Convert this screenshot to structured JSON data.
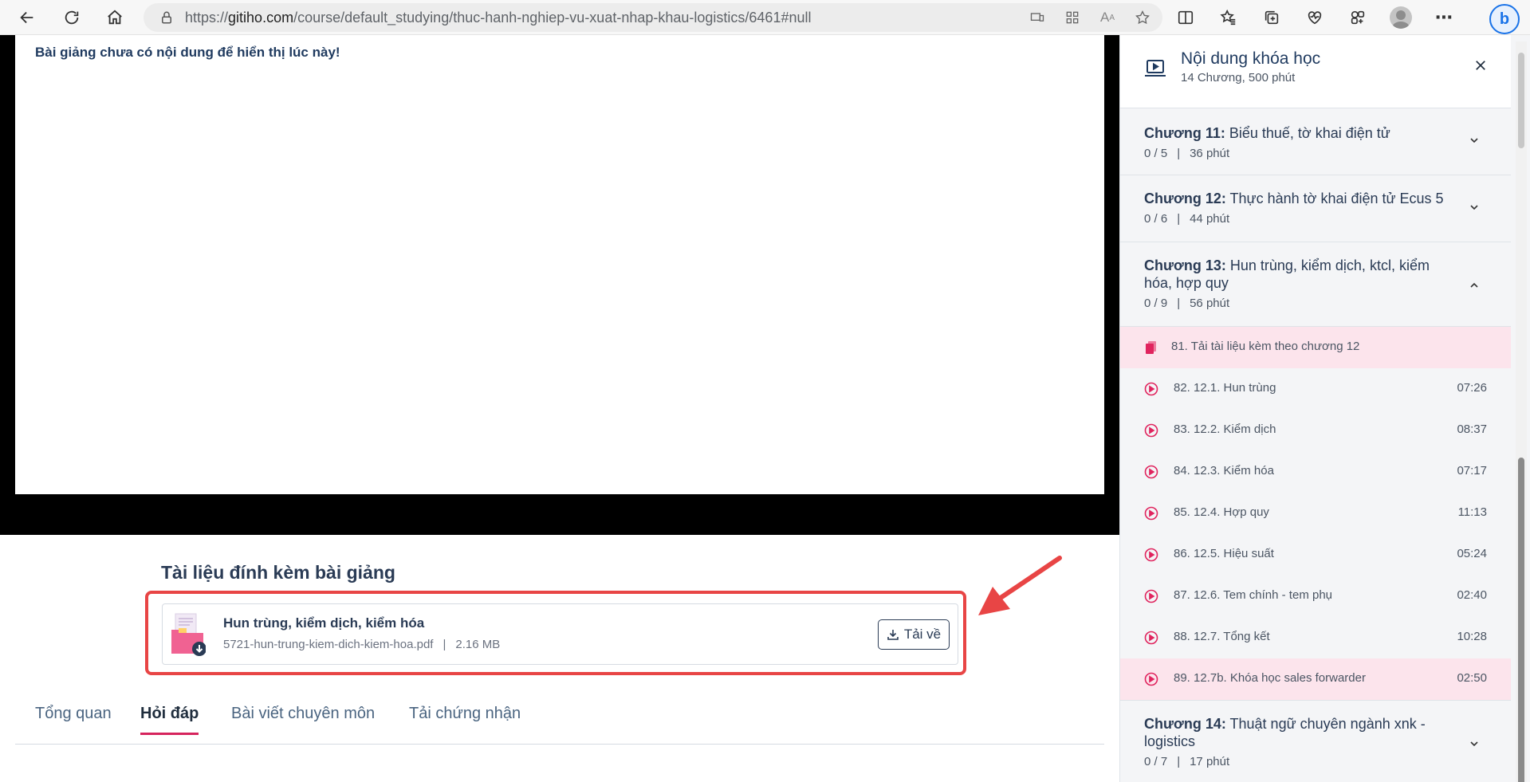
{
  "browser": {
    "url_prefix": "https://",
    "url_domain": "gitiho.com",
    "url_path": "/course/default_studying/thuc-hanh-nghiep-vu-xuat-nhap-khau-logistics/6461#null"
  },
  "lesson": {
    "empty_message": "Bài giảng chưa có nội dung để hiển thị lúc này!"
  },
  "attachments": {
    "title": "Tài liệu đính kèm bài giảng",
    "file_name": "Hun trùng, kiểm dịch, kiểm hóa",
    "file_path": "5721-hun-trung-kiem-dich-kiem-hoa.pdf",
    "file_size": "2.16 MB",
    "separator": "|",
    "download_label": "Tải về"
  },
  "tabs": [
    "Tổng quan",
    "Hỏi đáp",
    "Bài viết chuyên môn",
    "Tải chứng nhận"
  ],
  "active_tab": "Hỏi đáp",
  "sidebar": {
    "title": "Nội dung khóa học",
    "subtitle": "14 Chương, 500 phút",
    "chapters": [
      {
        "label": "Chương 11:",
        "name": "Biểu thuế, tờ khai điện tử",
        "progress": "0 / 5",
        "duration": "36 phút"
      },
      {
        "label": "Chương 12:",
        "name": "Thực hành tờ khai điện tử Ecus 5",
        "progress": "0 / 6",
        "duration": "44 phút"
      },
      {
        "label": "Chương 13:",
        "name": "Hun trùng, kiểm dịch, ktcl, kiểm hóa, hợp quy",
        "progress": "0 / 9",
        "duration": "56 phút"
      },
      {
        "label": "Chương 14:",
        "name": "Thuật ngữ chuyên ngành xnk - logistics",
        "progress": "0 / 7",
        "duration": "17 phút"
      }
    ],
    "separator": "|",
    "lessons": [
      {
        "name": "81. Tải tài liệu kèm theo chương 12",
        "duration": "",
        "type": "document",
        "highlight": true
      },
      {
        "name": "82. 12.1. Hun trùng",
        "duration": "07:26",
        "type": "video",
        "highlight": false
      },
      {
        "name": "83. 12.2. Kiểm dịch",
        "duration": "08:37",
        "type": "video",
        "highlight": false
      },
      {
        "name": "84. 12.3. Kiểm hóa",
        "duration": "07:17",
        "type": "video",
        "highlight": false
      },
      {
        "name": "85. 12.4. Hợp quy",
        "duration": "11:13",
        "type": "video",
        "highlight": false
      },
      {
        "name": "86. 12.5. Hiệu suất",
        "duration": "05:24",
        "type": "video",
        "highlight": false
      },
      {
        "name": "87. 12.6. Tem chính - tem phụ",
        "duration": "02:40",
        "type": "video",
        "highlight": false
      },
      {
        "name": "88. 12.7. Tổng kết",
        "duration": "10:28",
        "type": "video",
        "highlight": false
      },
      {
        "name": "89. 12.7b. Khóa học sales forwarder",
        "duration": "02:50",
        "type": "video",
        "highlight": true
      }
    ]
  },
  "colors": {
    "accent": "#e0245e",
    "highlight_bg": "#fce4ec",
    "annotation_red": "#e84545",
    "text_dark": "#2a3b55"
  }
}
